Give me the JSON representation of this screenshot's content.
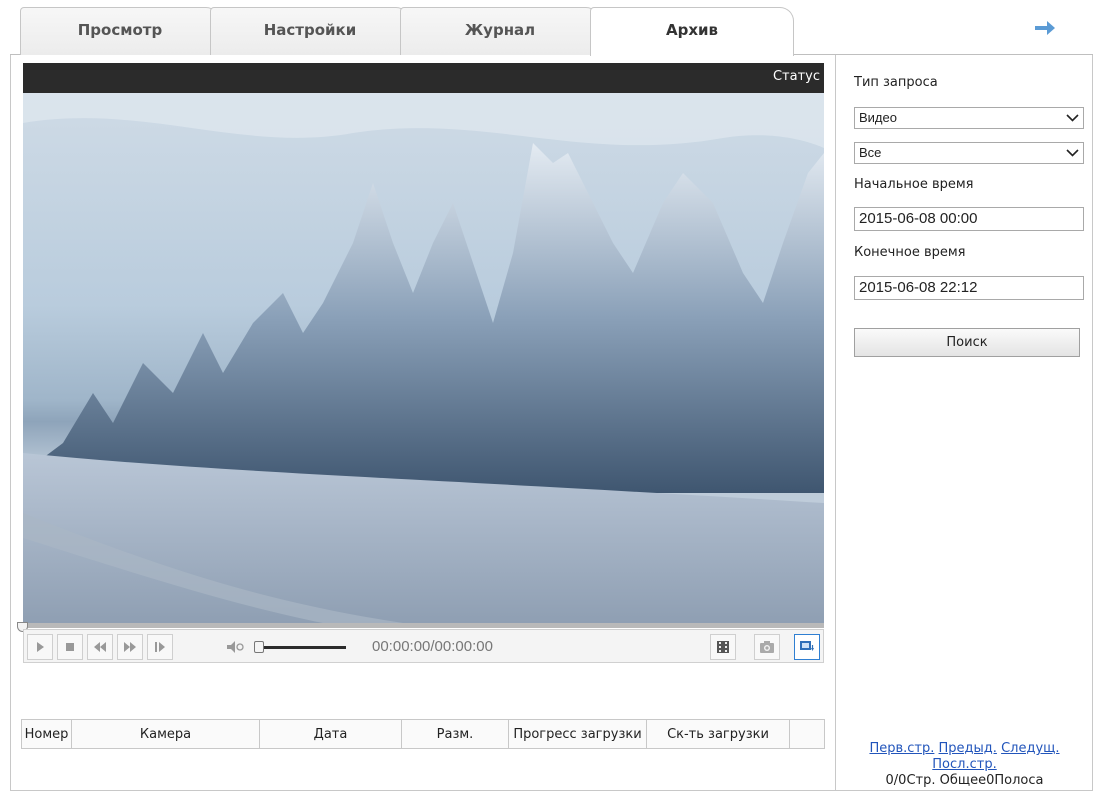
{
  "tabs": [
    {
      "label": "Просмотр",
      "active": false
    },
    {
      "label": "Настройки",
      "active": false
    },
    {
      "label": "Журнал",
      "active": false
    },
    {
      "label": "Архив",
      "active": true
    }
  ],
  "header": {
    "forward_icon": "arrow-right-icon",
    "accent": "#2f7fd2"
  },
  "player": {
    "status_label": "Статус",
    "timecode": "00:00:00/00:00:00",
    "seek_position": 0,
    "volume_level": 0,
    "controls": [
      "play-icon",
      "stop-icon",
      "rewind-icon",
      "fast-forward-icon",
      "step-frame-icon",
      "volume-icon",
      "filmstrip-icon",
      "camera-snapshot-icon",
      "download-icon"
    ]
  },
  "results_table": {
    "columns": [
      "Номер",
      "Камера",
      "Дата",
      "Разм.",
      "Прогресс загрузки",
      "Ск-ть загрузки",
      ""
    ]
  },
  "search": {
    "query_type_label": "Тип запроса",
    "type_select": "Видео",
    "filter_select": "Все",
    "start_label": "Начальное время",
    "start_value": "2015-06-08 00:00",
    "end_label": "Конечное время",
    "end_value": "2015-06-08 22:12",
    "search_button": "Поиск"
  },
  "pagination": {
    "first": "Перв.стр.",
    "prev": "Предыд.",
    "next": "Следущ.",
    "last": "Посл.стр.",
    "info": "0/0Стр. Общее0Полоса"
  }
}
